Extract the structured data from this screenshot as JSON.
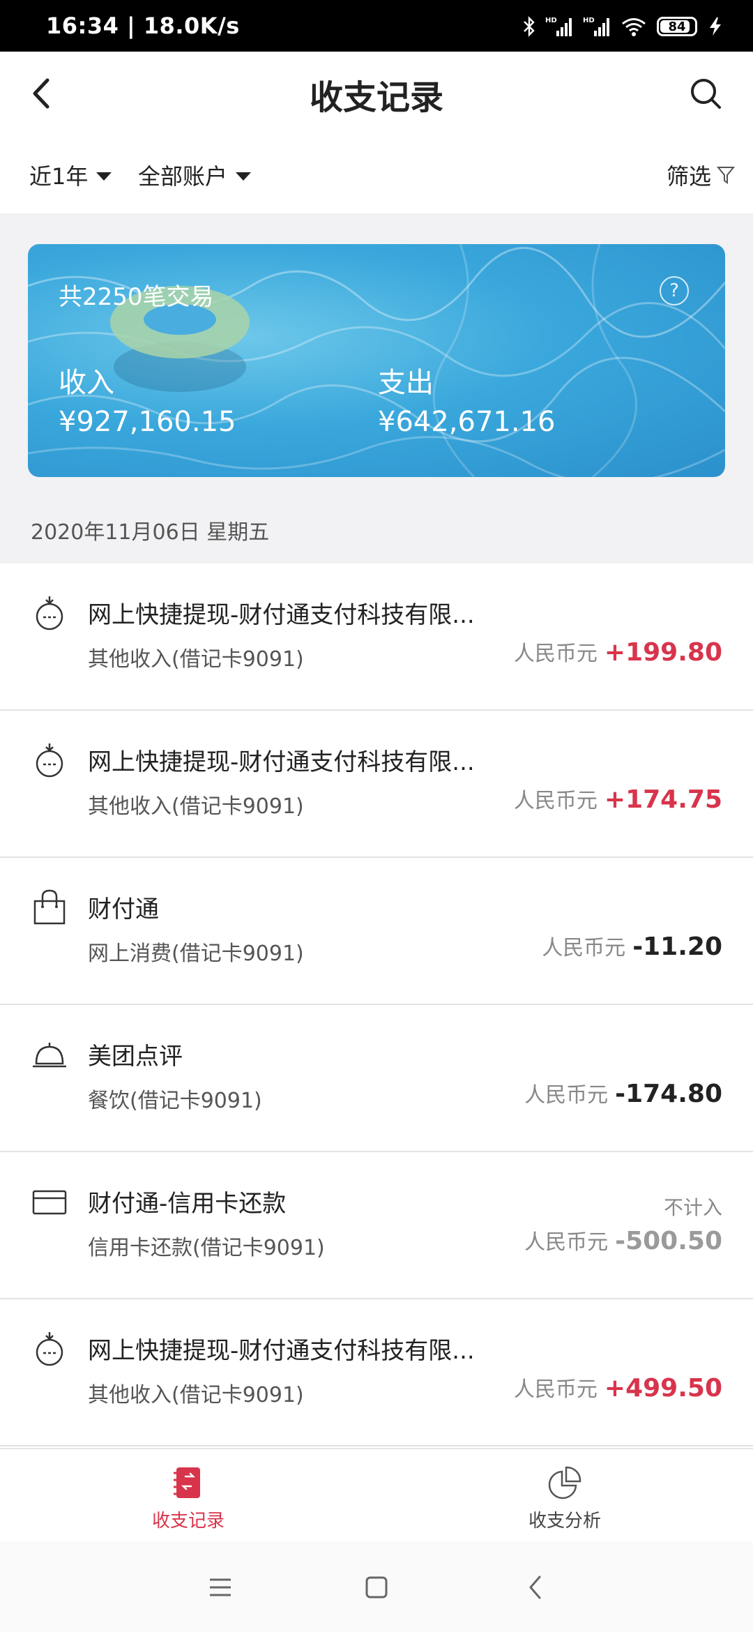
{
  "status_bar": {
    "time": "16:34 | 18.0K/s",
    "battery": "84",
    "icons": [
      "bluetooth-icon",
      "signal-hd-icon",
      "signal-hd-icon",
      "wifi-icon",
      "battery-icon",
      "charging-icon"
    ]
  },
  "header": {
    "title": "收支记录",
    "back_icon": "chevron-left-icon",
    "search_icon": "search-icon"
  },
  "filters": {
    "period": "近1年",
    "account": "全部账户",
    "filter_label": "筛选"
  },
  "summary": {
    "count_text": "共2250笔交易",
    "income_label": "收入",
    "income_value": "¥927,160.15",
    "expense_label": "支出",
    "expense_value": "¥642,671.16"
  },
  "date_header": "2020年11月06日 星期五",
  "transactions": [
    {
      "icon": "income-clock-icon",
      "name": "网上快捷提现-财付通支付科技有限...",
      "sub": "其他收入(借记卡9091)",
      "note": "",
      "currency": "人民币元",
      "amount": "+199.80",
      "kind": "pos"
    },
    {
      "icon": "income-clock-icon",
      "name": "网上快捷提现-财付通支付科技有限...",
      "sub": "其他收入(借记卡9091)",
      "note": "",
      "currency": "人民币元",
      "amount": "+174.75",
      "kind": "pos"
    },
    {
      "icon": "shopping-bag-icon",
      "name": "财付通",
      "sub": "网上消费(借记卡9091)",
      "note": "",
      "currency": "人民币元",
      "amount": "-11.20",
      "kind": "neg"
    },
    {
      "icon": "dining-bell-icon",
      "name": "美团点评",
      "sub": "餐饮(借记卡9091)",
      "note": "",
      "currency": "人民币元",
      "amount": "-174.80",
      "kind": "neg"
    },
    {
      "icon": "credit-card-icon",
      "name": "财付通-信用卡还款",
      "sub": "信用卡还款(借记卡9091)",
      "note": "不计入",
      "currency": "人民币元",
      "amount": "-500.50",
      "kind": "muted"
    },
    {
      "icon": "income-clock-icon",
      "name": "网上快捷提现-财付通支付科技有限...",
      "sub": "其他收入(借记卡9091)",
      "note": "",
      "currency": "人民币元",
      "amount": "+499.50",
      "kind": "pos"
    }
  ],
  "bottom_nav": [
    {
      "label": "收支记录",
      "icon": "ledger-icon",
      "active": true
    },
    {
      "label": "收支分析",
      "icon": "pie-chart-icon",
      "active": false
    }
  ],
  "colors": {
    "accent": "#d8344c",
    "card_blue": "#3aa8dc",
    "page_bg": "#f2f2f4"
  }
}
